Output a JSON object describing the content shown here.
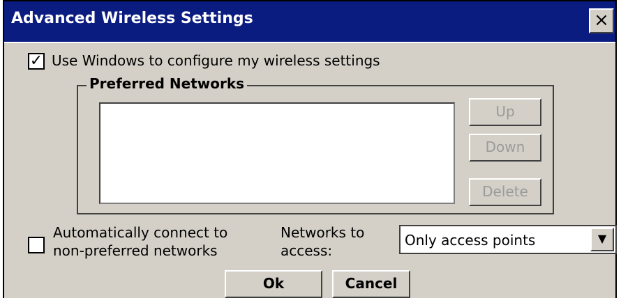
{
  "window": {
    "title": "Advanced Wireless Settings",
    "close_glyph": "×"
  },
  "use_windows": {
    "checked": true,
    "check_glyph": "✓",
    "label": "Use Windows to configure my wireless settings"
  },
  "preferred_networks": {
    "title": "Preferred Networks",
    "items": [],
    "buttons": {
      "up": "Up",
      "down": "Down",
      "delete": "Delete"
    }
  },
  "auto_connect": {
    "checked": false,
    "label_line1": "Automatically connect to",
    "label_line2": "non-preferred networks"
  },
  "networks_to_access": {
    "label_line1": "Networks to",
    "label_line2": "access:",
    "selected": "Only access points",
    "arrow_glyph": "▼"
  },
  "footer": {
    "ok": "Ok",
    "cancel": "Cancel"
  },
  "colors": {
    "titlebar": "#0a1c80",
    "face": "#d4d0c8",
    "disabled_text": "#9a9a9a"
  }
}
